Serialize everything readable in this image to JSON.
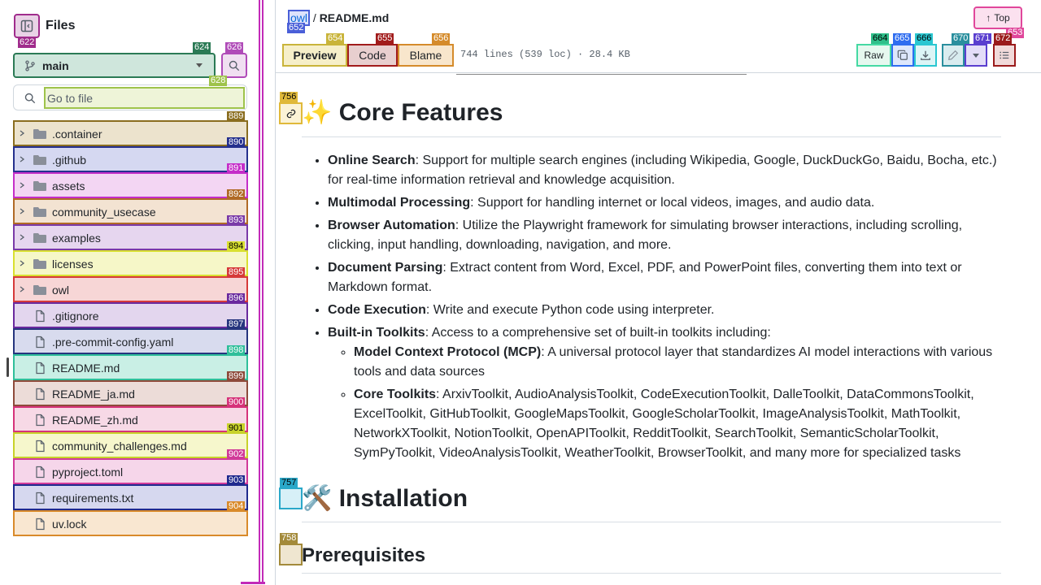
{
  "sidebar": {
    "title": "Files",
    "branch": "main",
    "goto_placeholder": "Go to file",
    "items": [
      {
        "name": ".container",
        "type": "folder"
      },
      {
        "name": ".github",
        "type": "folder"
      },
      {
        "name": "assets",
        "type": "folder"
      },
      {
        "name": "community_usecase",
        "type": "folder"
      },
      {
        "name": "examples",
        "type": "folder"
      },
      {
        "name": "licenses",
        "type": "folder"
      },
      {
        "name": "owl",
        "type": "folder"
      },
      {
        "name": ".gitignore",
        "type": "file"
      },
      {
        "name": ".pre-commit-config.yaml",
        "type": "file"
      },
      {
        "name": "README.md",
        "type": "file"
      },
      {
        "name": "README_ja.md",
        "type": "file"
      },
      {
        "name": "README_zh.md",
        "type": "file"
      },
      {
        "name": "community_challenges.md",
        "type": "file"
      },
      {
        "name": "pyproject.toml",
        "type": "file"
      },
      {
        "name": "requirements.txt",
        "type": "file"
      },
      {
        "name": "uv.lock",
        "type": "file"
      }
    ]
  },
  "header": {
    "repo": "owl",
    "sep": "/",
    "file": "README.md",
    "top_label": "Top",
    "tabs": {
      "preview": "Preview",
      "code": "Code",
      "blame": "Blame"
    },
    "meta": "744 lines (539 loc) · 28.4 KB",
    "raw": "Raw"
  },
  "annotations": {
    "a622": "622",
    "a624": "624",
    "a626": "626",
    "a628": "628",
    "a652": "652",
    "a654": "654",
    "a655": "655",
    "a656": "656",
    "a664": "664",
    "a665": "665",
    "a666": "666",
    "a670": "670",
    "a671": "671",
    "a672": "672",
    "a653": "653",
    "a756": "756",
    "a757": "757",
    "a758": "758",
    "rows": [
      "889",
      "890",
      "891",
      "892",
      "893",
      "894",
      "895",
      "896",
      "897",
      "898",
      "899",
      "900",
      "901",
      "902",
      "903",
      "904"
    ]
  },
  "content": {
    "features_heading_emoji": "✨",
    "features_heading": "Core Features",
    "features": [
      {
        "bold": "Online Search",
        "text": ": Support for multiple search engines (including Wikipedia, Google, DuckDuckGo, Baidu, Bocha, etc.) for real-time information retrieval and knowledge acquisition."
      },
      {
        "bold": "Multimodal Processing",
        "text": ": Support for handling internet or local videos, images, and audio data."
      },
      {
        "bold": "Browser Automation",
        "text": ": Utilize the Playwright framework for simulating browser interactions, including scrolling, clicking, input handling, downloading, navigation, and more."
      },
      {
        "bold": "Document Parsing",
        "text": ": Extract content from Word, Excel, PDF, and PowerPoint files, converting them into text or Markdown format."
      },
      {
        "bold": "Code Execution",
        "text": ": Write and execute Python code using interpreter."
      },
      {
        "bold": "Built-in Toolkits",
        "text": ": Access to a comprehensive set of built-in toolkits including:"
      }
    ],
    "subfeatures": [
      {
        "bold": "Model Context Protocol (MCP)",
        "text": ": A universal protocol layer that standardizes AI model interactions with various tools and data sources"
      },
      {
        "bold": "Core Toolkits",
        "text": ": ArxivToolkit, AudioAnalysisToolkit, CodeExecutionToolkit, DalleToolkit, DataCommonsToolkit, ExcelToolkit, GitHubToolkit, GoogleMapsToolkit, GoogleScholarToolkit, ImageAnalysisToolkit, MathToolkit, NetworkXToolkit, NotionToolkit, OpenAPIToolkit, RedditToolkit, SearchToolkit, SemanticScholarToolkit, SymPyToolkit, VideoAnalysisToolkit, WeatherToolkit, BrowserToolkit, and many more for specialized tasks"
      }
    ],
    "install_emoji": "🛠️",
    "install_heading": "Installation",
    "prereq_heading": "Prerequisites"
  }
}
